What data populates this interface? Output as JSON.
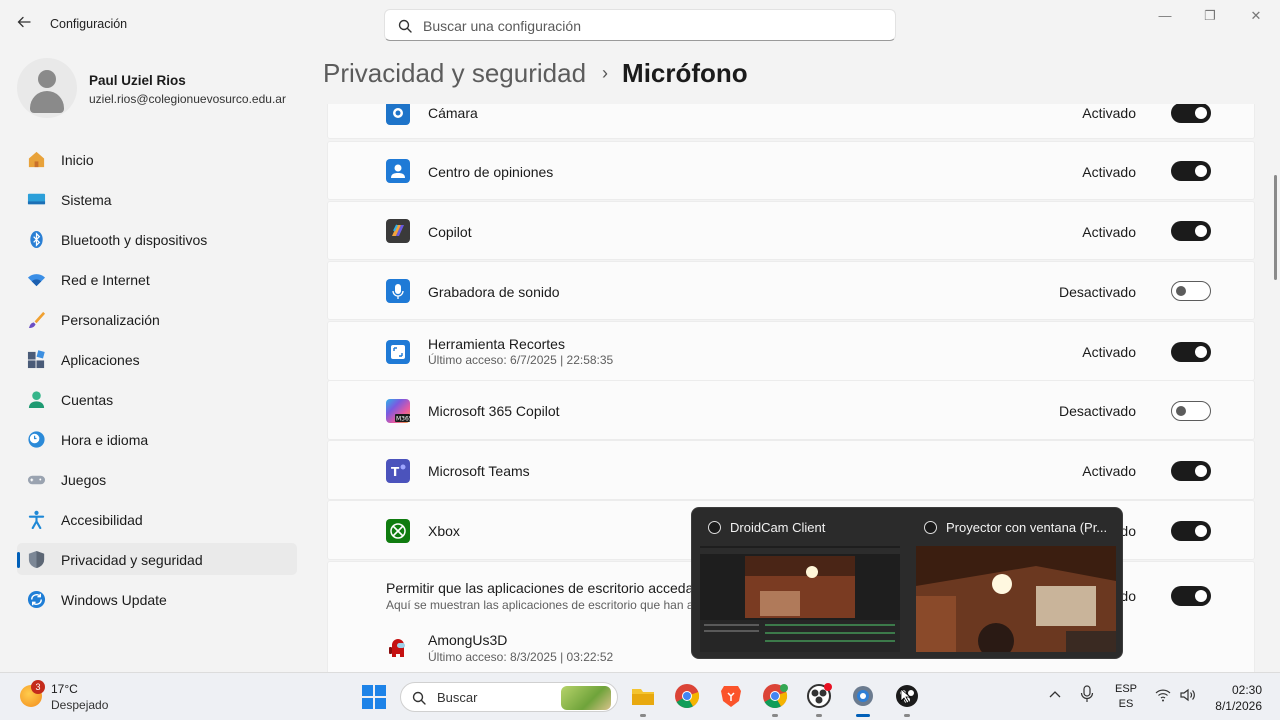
{
  "window": {
    "title": "Configuración"
  },
  "search": {
    "placeholder": "Buscar una configuración"
  },
  "profile": {
    "name": "Paul Uziel Rios",
    "email": "uziel.rios@colegionuevosurco.edu.ar"
  },
  "sidebar": {
    "items": [
      {
        "label": "Inicio",
        "icon": "home-icon"
      },
      {
        "label": "Sistema",
        "icon": "system-icon"
      },
      {
        "label": "Bluetooth y dispositivos",
        "icon": "bluetooth-icon"
      },
      {
        "label": "Red e Internet",
        "icon": "wifi-icon"
      },
      {
        "label": "Personalización",
        "icon": "brush-icon"
      },
      {
        "label": "Aplicaciones",
        "icon": "apps-icon"
      },
      {
        "label": "Cuentas",
        "icon": "person-icon"
      },
      {
        "label": "Hora e idioma",
        "icon": "clock-globe-icon"
      },
      {
        "label": "Juegos",
        "icon": "gamepad-icon"
      },
      {
        "label": "Accesibilidad",
        "icon": "accessibility-icon"
      },
      {
        "label": "Privacidad y seguridad",
        "icon": "shield-icon",
        "active": true
      },
      {
        "label": "Windows Update",
        "icon": "update-icon"
      }
    ]
  },
  "breadcrumb": {
    "parent": "Privacidad y seguridad",
    "separator": "›",
    "current": "Micrófono"
  },
  "apps": [
    {
      "name": "Cámara",
      "state": "Activado",
      "on": true
    },
    {
      "name": "Centro de opiniones",
      "state": "Activado",
      "on": true
    },
    {
      "name": "Copilot",
      "state": "Activado",
      "on": true
    },
    {
      "name": "Grabadora de sonido",
      "state": "Desactivado",
      "on": false
    },
    {
      "name": "Herramienta Recortes",
      "sub": "Último acceso: 6/7/2025  |  22:58:35",
      "state": "Activado",
      "on": true
    },
    {
      "name": "Microsoft 365 Copilot",
      "state": "Desactivado",
      "on": false
    },
    {
      "name": "Microsoft Teams",
      "state": "Activado",
      "on": true
    },
    {
      "name": "Xbox",
      "state": "Activado",
      "on": true
    }
  ],
  "desktop_section": {
    "title": "Permitir que las aplicaciones de escritorio accedan",
    "subtitle": "Aquí se muestran las aplicaciones de escritorio que han a",
    "state": "Activado",
    "on": true
  },
  "desktop_apps": [
    {
      "name": "AmongUs3D",
      "sub": "Último acceso: 8/3/2025  |  03:22:52"
    }
  ],
  "preview": {
    "windows": [
      {
        "title": "DroidCam Client"
      },
      {
        "title": "Proyector con ventana (Pr..."
      }
    ]
  },
  "taskbar": {
    "weather": {
      "temp": "17°C",
      "desc": "Despejado",
      "badge": "3"
    },
    "search_label": "Buscar",
    "language": {
      "line1": "ESP",
      "line2": "ES"
    },
    "time": "02:30",
    "date": "8/1/2026"
  }
}
